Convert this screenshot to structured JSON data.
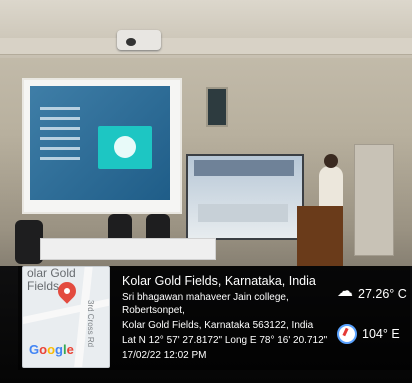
{
  "overlay": {
    "map_label": "olar Gold\nFields",
    "map_road": "3rd Cross Rd",
    "google": [
      "G",
      "o",
      "o",
      "g",
      "l",
      "e"
    ],
    "location_title": "Kolar Gold Fields, Karnataka, India",
    "address_line1": "Sri bhagawan mahaveer Jain college, Robertsonpet,",
    "address_line2": "Kolar Gold Fields, Karnataka 563122, India",
    "coords": "Lat N 12° 57' 27.8172\" Long E 78° 16' 20.712\"",
    "datetime": "17/02/22 12:02 PM",
    "temperature": "27.26° C",
    "heading": "104° E"
  },
  "colors": {
    "screen_teal": "#1dc6c3",
    "podium": "#6a3b1a"
  }
}
